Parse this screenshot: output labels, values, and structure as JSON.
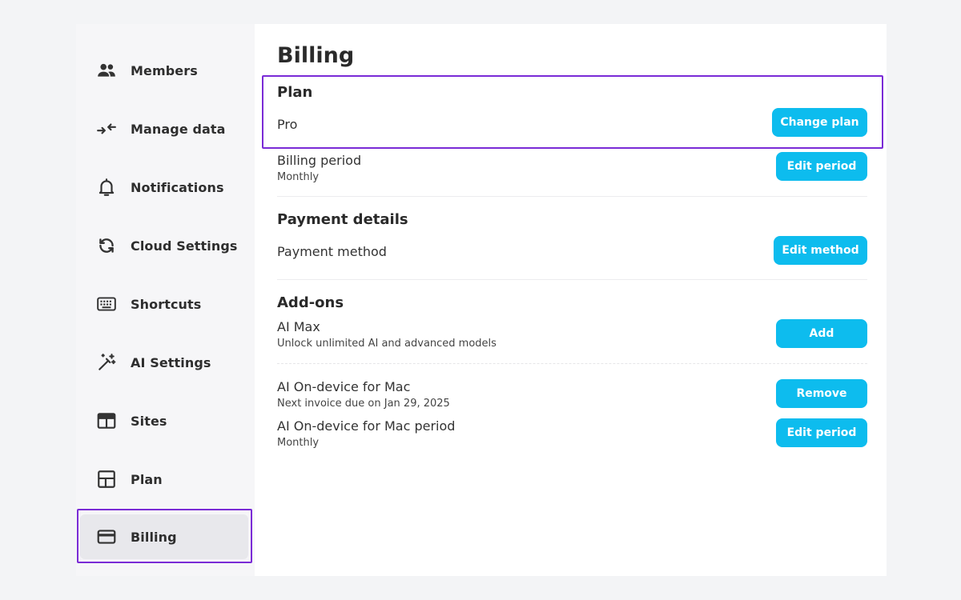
{
  "sidebar": {
    "items": [
      {
        "label": "Members"
      },
      {
        "label": "Manage data"
      },
      {
        "label": "Notifications"
      },
      {
        "label": "Cloud Settings"
      },
      {
        "label": "Shortcuts"
      },
      {
        "label": "AI Settings"
      },
      {
        "label": "Sites"
      },
      {
        "label": "Plan"
      },
      {
        "label": "Billing",
        "active": true
      }
    ]
  },
  "main": {
    "title": "Billing",
    "plan": {
      "section_title": "Plan",
      "current": "Pro",
      "button": "Change plan"
    },
    "billing_period": {
      "title": "Billing period",
      "value": "Monthly",
      "button": "Edit period"
    },
    "payment": {
      "section_title": "Payment details",
      "method_label": "Payment method",
      "button": "Edit method"
    },
    "addons": {
      "section_title": "Add-ons",
      "ai_max": {
        "title": "AI Max",
        "description": "Unlock unlimited AI and advanced models",
        "button": "Add"
      },
      "ai_on_device": {
        "title": "AI On-device for Mac",
        "description": "Next invoice due on Jan 29, 2025",
        "button": "Remove"
      },
      "ai_on_device_period": {
        "title": "AI On-device for Mac period",
        "value": "Monthly",
        "button": "Edit period"
      }
    }
  },
  "colors": {
    "accent": "#0dbcee",
    "highlight": "#7a2bd6",
    "sidebar_bg": "#f6f6f8",
    "page_bg": "#f3f4f6"
  }
}
